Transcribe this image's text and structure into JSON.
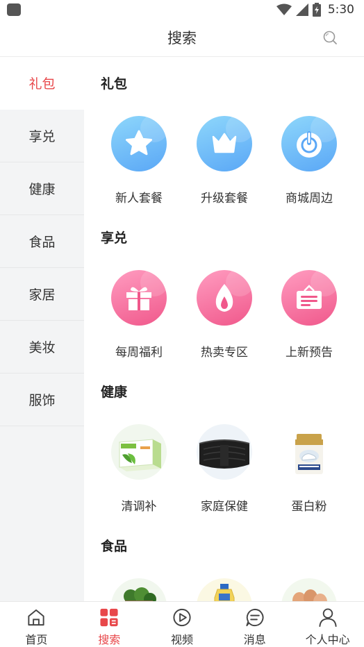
{
  "status_bar": {
    "time": "5:30"
  },
  "header": {
    "title": "搜索"
  },
  "sidebar": {
    "items": [
      {
        "label": "礼包",
        "active": true
      },
      {
        "label": "享兑"
      },
      {
        "label": "健康"
      },
      {
        "label": "食品"
      },
      {
        "label": "家居"
      },
      {
        "label": "美妆"
      },
      {
        "label": "服饰"
      }
    ]
  },
  "sections": [
    {
      "title": "礼包",
      "items": [
        {
          "label": "新人套餐",
          "icon": "star-icon"
        },
        {
          "label": "升级套餐",
          "icon": "crown-icon"
        },
        {
          "label": "商城周边",
          "icon": "power-icon"
        }
      ]
    },
    {
      "title": "享兑",
      "items": [
        {
          "label": "每周福利",
          "icon": "gift-icon"
        },
        {
          "label": "热卖专区",
          "icon": "flame-icon"
        },
        {
          "label": "上新预告",
          "icon": "notice-board-icon"
        }
      ]
    },
    {
      "title": "健康",
      "items": [
        {
          "label": "清调补",
          "icon": "tea-box-image"
        },
        {
          "label": "家庭保健",
          "icon": "waist-belt-image"
        },
        {
          "label": "蛋白粉",
          "icon": "protein-can-image"
        }
      ]
    },
    {
      "title": "食品",
      "items": [
        {
          "label": "",
          "icon": "vegetables-image"
        },
        {
          "label": "",
          "icon": "cooking-oil-image"
        },
        {
          "label": "",
          "icon": "eggs-image"
        }
      ]
    }
  ],
  "bottom_nav": {
    "items": [
      {
        "label": "首页",
        "icon": "home-icon"
      },
      {
        "label": "搜索",
        "icon": "search-grid-icon",
        "active": true
      },
      {
        "label": "视频",
        "icon": "play-icon"
      },
      {
        "label": "消息",
        "icon": "message-icon"
      },
      {
        "label": "个人中心",
        "icon": "person-icon"
      }
    ]
  },
  "colors": {
    "accent": "#e8474a",
    "blue_icon": "#5aa7f6",
    "pink_icon": "#f0588b",
    "sidebar_bg": "#f3f4f5"
  }
}
